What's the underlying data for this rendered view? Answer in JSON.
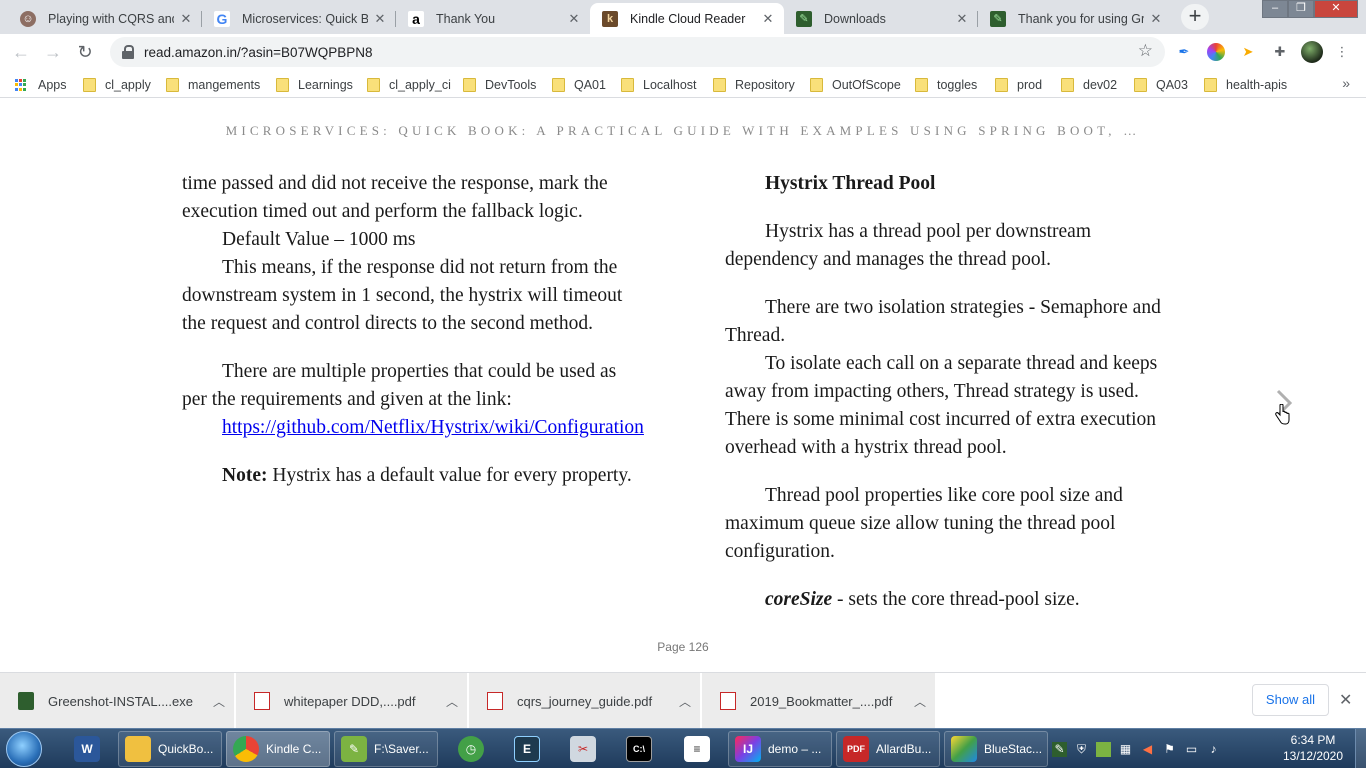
{
  "tabs": [
    {
      "title": "Playing with CQRS and E",
      "favicon": "profile-icon",
      "active": false
    },
    {
      "title": "Microservices: Quick Boo",
      "favicon": "google-icon",
      "active": false
    },
    {
      "title": "Thank You",
      "favicon": "amazon-icon",
      "active": false
    },
    {
      "title": "Kindle Cloud Reader",
      "favicon": "kindle-icon",
      "active": true
    },
    {
      "title": "Downloads",
      "favicon": "downloads-icon",
      "active": false
    },
    {
      "title": "Thank you for using Gree",
      "favicon": "greenshot-icon",
      "active": false
    }
  ],
  "address_bar": {
    "url": "read.amazon.in/?asin=B07WQPBPN8"
  },
  "bookmarks": {
    "apps_label": "Apps",
    "items": [
      "cl_apply",
      "mangements",
      "Learnings",
      "cl_apply_ci",
      "DevTools",
      "QA01",
      "Localhost",
      "Repository",
      "OutOfScope",
      "toggles",
      "prod",
      "dev02",
      "QA03",
      "health-apis"
    ]
  },
  "reader": {
    "book_title": "MICROSERVICES: QUICK BOOK: A PRACTICAL GUIDE WITH EXAMPLES USING SPRING BOOT, …",
    "left": {
      "p1": "time passed and did not receive the response, mark the execution timed out and perform the fallback logic.",
      "p2": "Default Value – 1000 ms",
      "p3": "This means, if the response did not return from the downstream system in 1 second, the hystrix will timeout the request and control directs to the second method.",
      "p4": "There are multiple properties that could be used as per the requirements and given at the link:",
      "link": "https://github.com/Netflix/Hystrix/wiki/Configuration",
      "note_label": "Note:",
      "note_text": " Hystrix has a default value for every property."
    },
    "right": {
      "heading": "Hystrix Thread Pool",
      "p1": "Hystrix has a thread pool per downstream dependency and manages the thread pool.",
      "p2": "There are two isolation strategies - Semaphore and Thread.",
      "p3": "To isolate each call on a separate thread and keeps away from impacting others, Thread strategy is used. There is some minimal cost incurred of extra execution overhead with a hystrix thread pool.",
      "p4": "Thread pool properties like core pool size and maximum queue size allow tuning the thread pool configuration.",
      "core_label": "coreSize",
      "core_text": " - sets the core thread-pool size."
    },
    "page_label": "Page 126"
  },
  "downloads": {
    "items": [
      {
        "name": "Greenshot-INSTAL....exe",
        "icon": "exe-file-icon"
      },
      {
        "name": "whitepaper DDD,....pdf",
        "icon": "pdf-file-icon"
      },
      {
        "name": "cqrs_journey_guide.pdf",
        "icon": "pdf-file-icon"
      },
      {
        "name": "2019_Bookmatter_....pdf",
        "icon": "pdf-file-icon"
      }
    ],
    "show_all": "Show all"
  },
  "taskbar": {
    "items": [
      {
        "label": "",
        "icon": "word-icon"
      },
      {
        "label": "QuickBo...",
        "icon": "folder-icon"
      },
      {
        "label": "Kindle C...",
        "icon": "chrome-icon"
      },
      {
        "label": "F:\\Saver...",
        "icon": "notepad-icon"
      },
      {
        "label": "",
        "icon": "clock-app-icon"
      },
      {
        "label": "",
        "icon": "editor-icon"
      },
      {
        "label": "",
        "icon": "snipping-tool-icon"
      },
      {
        "label": "",
        "icon": "cmd-icon"
      },
      {
        "label": "",
        "icon": "document-icon"
      },
      {
        "label": "demo – ...",
        "icon": "intellij-icon"
      },
      {
        "label": "AllardBu...",
        "icon": "pdf-reader-icon"
      },
      {
        "label": "BlueStac...",
        "icon": "bluestacks-icon"
      }
    ],
    "clock_time": "6:34 PM",
    "clock_date": "13/12/2020"
  },
  "colors": {
    "tab_strip": "#dee1e6",
    "link": "#0000ee",
    "show_all": "#1a73e8",
    "taskbar": "#2b4a6e"
  }
}
